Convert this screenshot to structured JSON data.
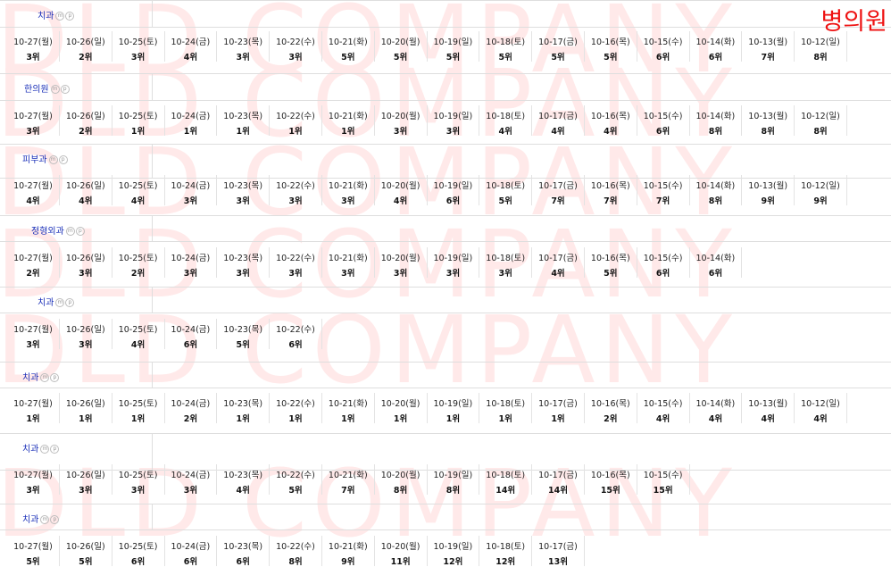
{
  "corner_label": "병의원",
  "watermark_text": "DLD COMPANY",
  "sections": [
    {
      "name": "치과",
      "cells": [
        {
          "date": "10-27(월)",
          "rank": "3위"
        },
        {
          "date": "10-26(일)",
          "rank": "2위"
        },
        {
          "date": "10-25(토)",
          "rank": "3위"
        },
        {
          "date": "10-24(금)",
          "rank": "4위"
        },
        {
          "date": "10-23(목)",
          "rank": "3위"
        },
        {
          "date": "10-22(수)",
          "rank": "3위"
        },
        {
          "date": "10-21(화)",
          "rank": "5위"
        },
        {
          "date": "10-20(월)",
          "rank": "5위"
        },
        {
          "date": "10-19(일)",
          "rank": "5위"
        },
        {
          "date": "10-18(토)",
          "rank": "5위"
        },
        {
          "date": "10-17(금)",
          "rank": "5위"
        },
        {
          "date": "10-16(목)",
          "rank": "5위"
        },
        {
          "date": "10-15(수)",
          "rank": "6위"
        },
        {
          "date": "10-14(화)",
          "rank": "6위"
        },
        {
          "date": "10-13(월)",
          "rank": "7위"
        },
        {
          "date": "10-12(일)",
          "rank": "8위"
        }
      ]
    },
    {
      "name": "한의원",
      "cells": [
        {
          "date": "10-27(월)",
          "rank": "3위"
        },
        {
          "date": "10-26(일)",
          "rank": "2위"
        },
        {
          "date": "10-25(토)",
          "rank": "1위"
        },
        {
          "date": "10-24(금)",
          "rank": "1위"
        },
        {
          "date": "10-23(목)",
          "rank": "1위"
        },
        {
          "date": "10-22(수)",
          "rank": "1위"
        },
        {
          "date": "10-21(화)",
          "rank": "1위"
        },
        {
          "date": "10-20(월)",
          "rank": "3위"
        },
        {
          "date": "10-19(일)",
          "rank": "3위"
        },
        {
          "date": "10-18(토)",
          "rank": "4위"
        },
        {
          "date": "10-17(금)",
          "rank": "4위"
        },
        {
          "date": "10-16(목)",
          "rank": "4위"
        },
        {
          "date": "10-15(수)",
          "rank": "6위"
        },
        {
          "date": "10-14(화)",
          "rank": "8위"
        },
        {
          "date": "10-13(월)",
          "rank": "8위"
        },
        {
          "date": "10-12(일)",
          "rank": "8위"
        }
      ]
    },
    {
      "name": "피부과",
      "cells": [
        {
          "date": "10-27(월)",
          "rank": "4위"
        },
        {
          "date": "10-26(일)",
          "rank": "4위"
        },
        {
          "date": "10-25(토)",
          "rank": "4위"
        },
        {
          "date": "10-24(금)",
          "rank": "3위"
        },
        {
          "date": "10-23(목)",
          "rank": "3위"
        },
        {
          "date": "10-22(수)",
          "rank": "3위"
        },
        {
          "date": "10-21(화)",
          "rank": "3위"
        },
        {
          "date": "10-20(월)",
          "rank": "4위"
        },
        {
          "date": "10-19(일)",
          "rank": "6위"
        },
        {
          "date": "10-18(토)",
          "rank": "5위"
        },
        {
          "date": "10-17(금)",
          "rank": "7위"
        },
        {
          "date": "10-16(목)",
          "rank": "7위"
        },
        {
          "date": "10-15(수)",
          "rank": "7위"
        },
        {
          "date": "10-14(화)",
          "rank": "8위"
        },
        {
          "date": "10-13(월)",
          "rank": "9위"
        },
        {
          "date": "10-12(일)",
          "rank": "9위"
        }
      ]
    },
    {
      "name": "정형외과",
      "cells": [
        {
          "date": "10-27(월)",
          "rank": "2위"
        },
        {
          "date": "10-26(일)",
          "rank": "3위"
        },
        {
          "date": "10-25(토)",
          "rank": "2위"
        },
        {
          "date": "10-24(금)",
          "rank": "3위"
        },
        {
          "date": "10-23(목)",
          "rank": "3위"
        },
        {
          "date": "10-22(수)",
          "rank": "3위"
        },
        {
          "date": "10-21(화)",
          "rank": "3위"
        },
        {
          "date": "10-20(월)",
          "rank": "3위"
        },
        {
          "date": "10-19(일)",
          "rank": "3위"
        },
        {
          "date": "10-18(토)",
          "rank": "3위"
        },
        {
          "date": "10-17(금)",
          "rank": "4위"
        },
        {
          "date": "10-16(목)",
          "rank": "5위"
        },
        {
          "date": "10-15(수)",
          "rank": "6위"
        },
        {
          "date": "10-14(화)",
          "rank": "6위"
        }
      ]
    },
    {
      "name": "치과",
      "cells": [
        {
          "date": "10-27(월)",
          "rank": "3위"
        },
        {
          "date": "10-26(일)",
          "rank": "3위"
        },
        {
          "date": "10-25(토)",
          "rank": "4위"
        },
        {
          "date": "10-24(금)",
          "rank": "6위"
        },
        {
          "date": "10-23(목)",
          "rank": "5위"
        },
        {
          "date": "10-22(수)",
          "rank": "6위"
        }
      ]
    },
    {
      "name": "치과",
      "cells": [
        {
          "date": "10-27(월)",
          "rank": "1위"
        },
        {
          "date": "10-26(일)",
          "rank": "1위"
        },
        {
          "date": "10-25(토)",
          "rank": "1위"
        },
        {
          "date": "10-24(금)",
          "rank": "2위"
        },
        {
          "date": "10-23(목)",
          "rank": "1위"
        },
        {
          "date": "10-22(수)",
          "rank": "1위"
        },
        {
          "date": "10-21(화)",
          "rank": "1위"
        },
        {
          "date": "10-20(월)",
          "rank": "1위"
        },
        {
          "date": "10-19(일)",
          "rank": "1위"
        },
        {
          "date": "10-18(토)",
          "rank": "1위"
        },
        {
          "date": "10-17(금)",
          "rank": "1위"
        },
        {
          "date": "10-16(목)",
          "rank": "2위"
        },
        {
          "date": "10-15(수)",
          "rank": "4위"
        },
        {
          "date": "10-14(화)",
          "rank": "4위"
        },
        {
          "date": "10-13(월)",
          "rank": "4위"
        },
        {
          "date": "10-12(일)",
          "rank": "4위"
        }
      ]
    },
    {
      "name": "치과",
      "cells": [
        {
          "date": "10-27(월)",
          "rank": "3위"
        },
        {
          "date": "10-26(일)",
          "rank": "3위"
        },
        {
          "date": "10-25(토)",
          "rank": "3위"
        },
        {
          "date": "10-24(금)",
          "rank": "3위"
        },
        {
          "date": "10-23(목)",
          "rank": "4위"
        },
        {
          "date": "10-22(수)",
          "rank": "5위"
        },
        {
          "date": "10-21(화)",
          "rank": "7위"
        },
        {
          "date": "10-20(월)",
          "rank": "8위"
        },
        {
          "date": "10-19(일)",
          "rank": "8위"
        },
        {
          "date": "10-18(토)",
          "rank": "14위"
        },
        {
          "date": "10-17(금)",
          "rank": "14위"
        },
        {
          "date": "10-16(목)",
          "rank": "15위"
        },
        {
          "date": "10-15(수)",
          "rank": "15위"
        }
      ]
    },
    {
      "name": "치과",
      "cells": [
        {
          "date": "10-27(월)",
          "rank": "5위"
        },
        {
          "date": "10-26(일)",
          "rank": "5위"
        },
        {
          "date": "10-25(토)",
          "rank": "6위"
        },
        {
          "date": "10-24(금)",
          "rank": "6위"
        },
        {
          "date": "10-23(목)",
          "rank": "6위"
        },
        {
          "date": "10-22(수)",
          "rank": "8위"
        },
        {
          "date": "10-21(화)",
          "rank": "9위"
        },
        {
          "date": "10-20(월)",
          "rank": "11위"
        },
        {
          "date": "10-19(일)",
          "rank": "12위"
        },
        {
          "date": "10-18(토)",
          "rank": "12위"
        },
        {
          "date": "10-17(금)",
          "rank": "13위"
        }
      ]
    }
  ]
}
